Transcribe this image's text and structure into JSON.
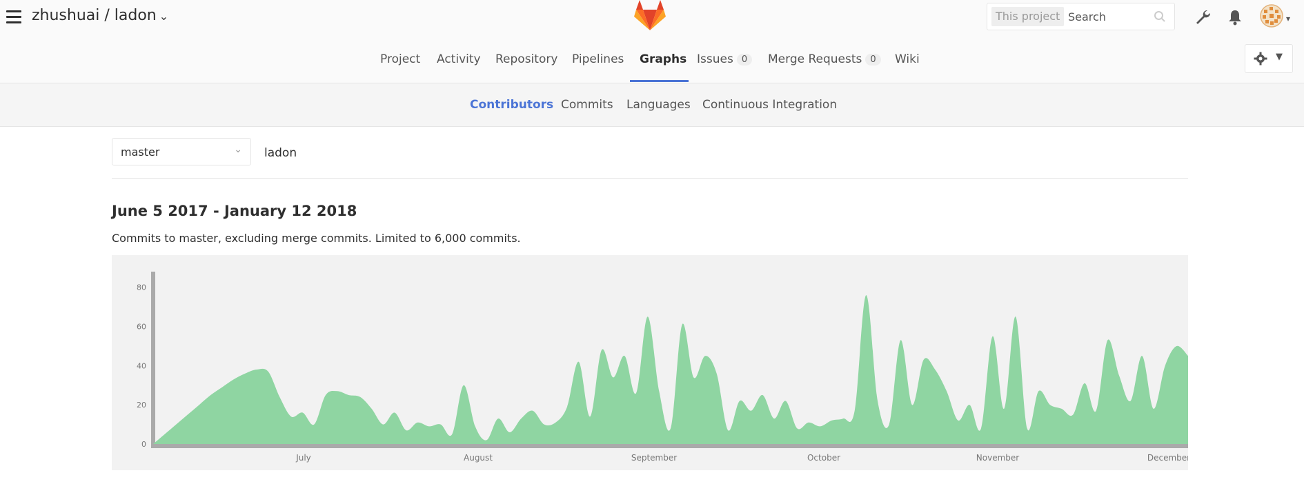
{
  "header": {
    "project_path": "zhushuai / ladon",
    "search_scope": "This project",
    "search_placeholder": "Search"
  },
  "main_nav": [
    {
      "label": "Project"
    },
    {
      "label": "Activity"
    },
    {
      "label": "Repository"
    },
    {
      "label": "Pipelines"
    },
    {
      "label": "Graphs",
      "active": true
    },
    {
      "label": "Issues",
      "badge": "0"
    },
    {
      "label": "Merge Requests",
      "badge": "0"
    },
    {
      "label": "Wiki"
    }
  ],
  "sub_nav": [
    {
      "label": "Contributors",
      "active": true
    },
    {
      "label": "Commits"
    },
    {
      "label": "Languages"
    },
    {
      "label": "Continuous Integration"
    }
  ],
  "filters": {
    "branch": "master",
    "project": "ladon"
  },
  "summary": {
    "date_range": "June 5 2017 - January 12 2018",
    "description": "Commits to master, excluding merge commits. Limited to 6,000 commits."
  },
  "colors": {
    "accent": "#4b74d6",
    "area_fill": "#8fd5a2",
    "chart_bg": "#f2f2f2"
  },
  "chart_data": {
    "type": "area",
    "title": "",
    "xlabel": "",
    "ylabel": "",
    "ylim": [
      0,
      88
    ],
    "yticks": [
      0,
      20,
      40,
      60,
      80
    ],
    "xticks": [
      "July",
      "August",
      "September",
      "October",
      "November",
      "December"
    ],
    "x_range": [
      "2017-06-05",
      "2017-12-29"
    ],
    "series": [
      {
        "values": [
          0,
          5,
          10,
          15,
          20,
          25,
          29,
          33,
          36,
          38,
          37,
          24,
          14,
          16,
          10,
          25,
          27,
          25,
          24,
          18,
          10,
          16,
          7,
          11,
          9,
          10,
          5,
          30,
          9,
          2,
          13,
          6,
          13,
          17,
          10,
          11,
          19,
          42,
          14,
          48,
          34,
          45,
          26,
          65,
          27,
          8,
          61,
          34,
          45,
          36,
          7,
          22,
          17,
          25,
          13,
          22,
          8,
          11,
          9,
          12,
          13,
          17,
          76,
          22,
          10,
          53,
          20,
          43,
          38,
          27,
          12,
          20,
          8,
          55,
          18,
          65,
          8,
          27,
          20,
          18,
          15,
          31,
          17,
          53,
          35,
          22,
          45,
          18,
          40,
          50,
          45
        ]
      }
    ]
  }
}
